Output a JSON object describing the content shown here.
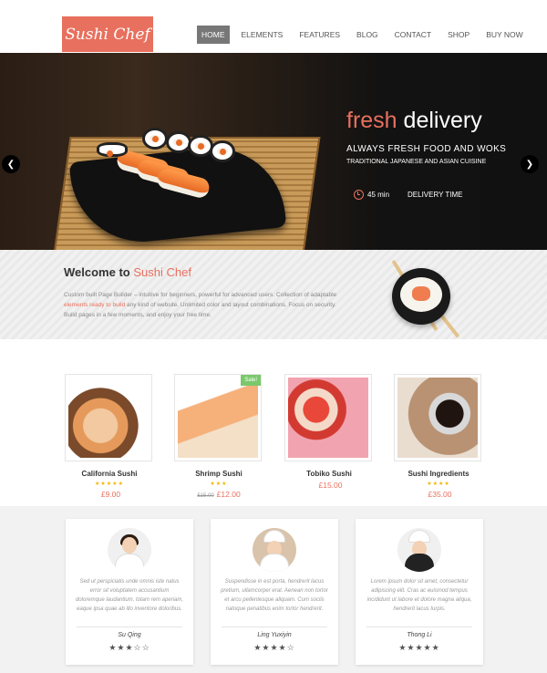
{
  "brand": {
    "logo_text": "Sushi Chef",
    "accent_color": "#e8705e"
  },
  "nav": {
    "items": [
      "HOME",
      "ELEMENTS",
      "FEATURES",
      "BLOG",
      "CONTACT",
      "SHOP",
      "BUY NOW"
    ],
    "active": "HOME"
  },
  "hero": {
    "title_accent": "fresh",
    "title_rest": "delivery",
    "subtitle": "ALWAYS FRESH FOOD AND WOKS",
    "subtitle2": "TRADITIONAL JAPANESE AND ASIAN CUISINE",
    "time": "45 min",
    "delivery_label": "DELIVERY TIME",
    "prev_icon": "chevron-left-icon",
    "next_icon": "chevron-right-icon"
  },
  "welcome": {
    "title_prefix": "Welcome to",
    "title_accent": "Sushi Chef",
    "text_part1": "Custom built Page Builder – intuitive for beginners, powerful for advanced users. Collection of adaptable ",
    "text_accent": "elements ready to build",
    "text_part2": " any kind of website. Unlimited color and layout combinations. Focus on security. Build pages in a few moments, and enjoy your free time."
  },
  "products": [
    {
      "name": "California Sushi",
      "stars": "★★★★★",
      "old_price": "",
      "price": "£9.00",
      "sale": ""
    },
    {
      "name": "Shrimp Sushi",
      "stars": "★★★",
      "old_price": "£15.00",
      "price": "£12.00",
      "sale": "Sale!"
    },
    {
      "name": "Tobiko Sushi",
      "stars": "",
      "old_price": "",
      "price": "£15.00",
      "sale": ""
    },
    {
      "name": "Sushi Ingredients",
      "stars": "★★★★",
      "old_price": "",
      "price": "£35.00",
      "sale": ""
    }
  ],
  "testimonials": [
    {
      "quote": "Sed ut perspiciatis unde omnis iste natus error sit voluptatem accusantium doloremque laudantium, totam rem aperiam, eaque ipsa quae ab illo inventore doloribus.",
      "name": "Su Qing",
      "stars": "★★★☆☆"
    },
    {
      "quote": "Suspendisse in est porta, hendrerit lacus pretium, ullamcorper erat. Aenean non tortor et arcu pellentesque aliquam. Cum sociis natoque penatibus enim tortor hendrerit.",
      "name": "Ling Yuxiyin",
      "stars": "★★★★☆"
    },
    {
      "quote": "Lorem ipsum dolor sit amet, consectetur adipiscing elit. Cras ac euismod tempus incididunt ut labore et dolore magna aliqua, hendrerit lacus turpis.",
      "name": "Thong Li",
      "stars": "★★★★★"
    }
  ]
}
